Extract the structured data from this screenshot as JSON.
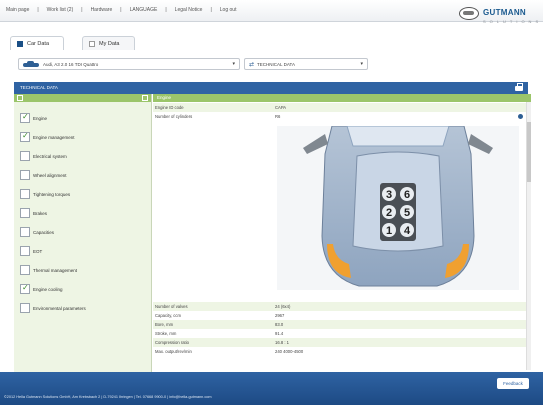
{
  "topnav": [
    "Main page",
    "Work list (2)",
    "Hardware",
    "LANGUAGE",
    "Legal Notice",
    "Log out"
  ],
  "logo": {
    "brand": "GUTMANN",
    "sub": "SOLUTIONS"
  },
  "tabs": [
    {
      "label": "Car Data"
    },
    {
      "label": "My Data"
    }
  ],
  "vehicle_select": {
    "value": "Audi, A3 2.0 16 TDI Quattro"
  },
  "data_select": {
    "value": "TECHNICAL DATA"
  },
  "panel": {
    "title": "TECHNICAL DATA"
  },
  "categories": [
    {
      "label": "Engine",
      "checked": true
    },
    {
      "label": "Engine management",
      "checked": true
    },
    {
      "label": "Electrical system",
      "checked": false
    },
    {
      "label": "Wheel alignment",
      "checked": false
    },
    {
      "label": "Tightening torques",
      "checked": false
    },
    {
      "label": "Brakes",
      "checked": false
    },
    {
      "label": "Capacities",
      "checked": false
    },
    {
      "label": "EOT",
      "checked": false
    },
    {
      "label": "Thermal management",
      "checked": false
    },
    {
      "label": "Engine cooling",
      "checked": true
    },
    {
      "label": "Environmental parameters",
      "checked": false
    }
  ],
  "detail": {
    "header": "Engine",
    "top_rows": [
      {
        "k": "Engine ID code",
        "v": "CAPA"
      },
      {
        "k": "Number of cylinders",
        "v": "R6"
      }
    ],
    "rows": [
      {
        "k": "Number of valves",
        "v": "24 (6x4)"
      },
      {
        "k": "Capacity, ccm",
        "v": "2967"
      },
      {
        "k": "Bore, mm",
        "v": "83.0"
      },
      {
        "k": "Stroke, mm",
        "v": "91.4"
      },
      {
        "k": "Compression ratio",
        "v": "16.8 : 1"
      },
      {
        "k": "Max. output/rev/min",
        "v": "240 4000-4500"
      }
    ],
    "cylinders": [
      "3",
      "6",
      "2",
      "5",
      "1",
      "4"
    ]
  },
  "footer": {
    "feedback": "Feedback",
    "copyright": "©2012 Hella Gutmann Solutions GmbH, Am Krebsbach 2 | D-79241 Ihringen | Tel. 07668 9900-0 | info@hella-gutmann.com"
  }
}
